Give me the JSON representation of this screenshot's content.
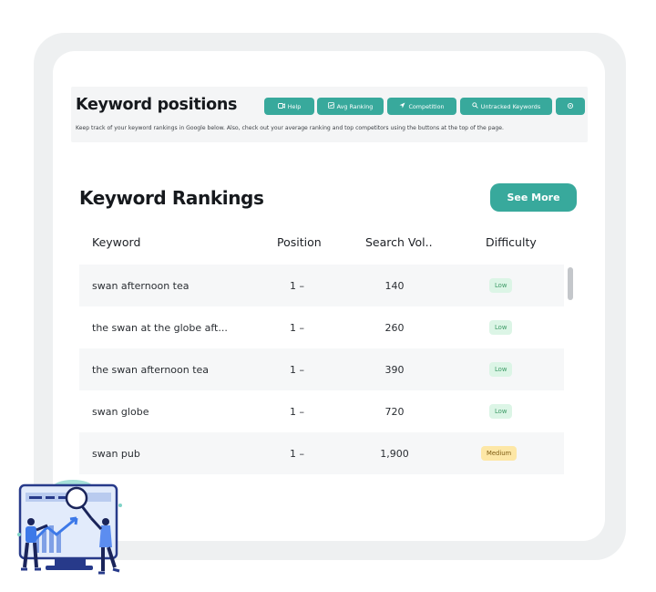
{
  "header": {
    "title": "Keyword positions",
    "description": "Keep track of your keyword rankings in Google below. Also, check out your average ranking and top competitors using the buttons at the top of the page.",
    "buttons": [
      {
        "label": "Help",
        "icon": "video-icon"
      },
      {
        "label": "Avg Ranking",
        "icon": "chart-icon"
      },
      {
        "label": "Competition",
        "icon": "send-icon"
      },
      {
        "label": "Untracked Keywords",
        "icon": "search-icon"
      },
      {
        "label": "",
        "icon": "settings-icon"
      }
    ]
  },
  "rankings": {
    "title": "Keyword Rankings",
    "see_more_label": "See More",
    "columns": [
      "Keyword",
      "Position",
      "Search Vol..",
      "Difficulty"
    ],
    "rows": [
      {
        "keyword": "swan afternoon tea",
        "position": "1 –",
        "volume": "140",
        "difficulty": "Low"
      },
      {
        "keyword": "the swan at the globe aft...",
        "position": "1 –",
        "volume": "260",
        "difficulty": "Low"
      },
      {
        "keyword": "the swan afternoon tea",
        "position": "1 –",
        "volume": "390",
        "difficulty": "Low"
      },
      {
        "keyword": "swan globe",
        "position": "1 –",
        "volume": "720",
        "difficulty": "Low"
      },
      {
        "keyword": "swan pub",
        "position": "1 –",
        "volume": "1,900",
        "difficulty": "Medium"
      }
    ]
  },
  "colors": {
    "accent": "#38a99c",
    "low_badge_bg": "#dcf5e6",
    "low_badge_text": "#3d9a66",
    "medium_badge_bg": "#fde7a6",
    "medium_badge_text": "#7d5b12"
  }
}
